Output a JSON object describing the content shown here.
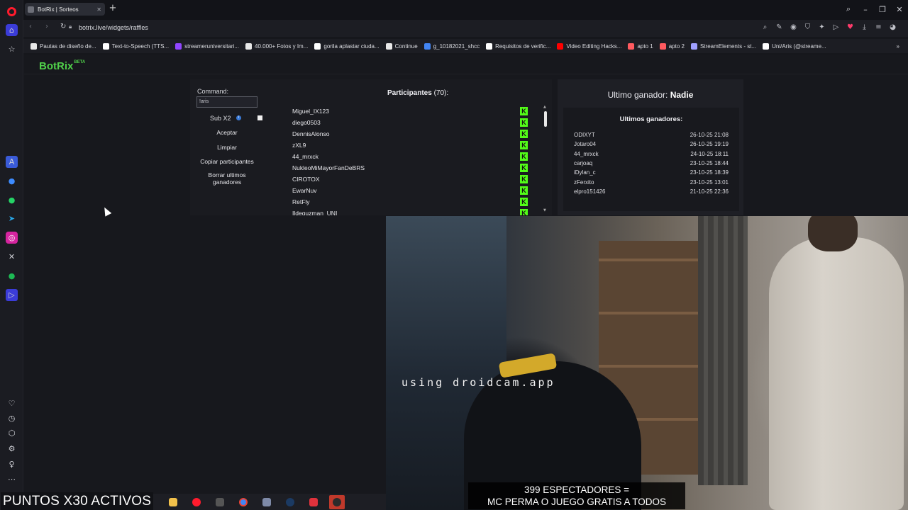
{
  "browser": {
    "tab_title": "BotRix | Sorteos",
    "url": "botrix.live/widgets/raffles",
    "bookmarks": [
      {
        "label": "Pautas de diseño de...",
        "color": "#e8e8e8"
      },
      {
        "label": "Text-to-Speech (TTS...",
        "color": "#ffffff"
      },
      {
        "label": "streameruniversitari...",
        "color": "#9146ff"
      },
      {
        "label": "40.000+ Fotos y Im...",
        "color": "#e8e8e8"
      },
      {
        "label": "gorila aplastar ciuda...",
        "color": "#ffffff"
      },
      {
        "label": "Continue",
        "color": "#e8e8e8"
      },
      {
        "label": "g_10182021_shcc",
        "color": "#4285f4"
      },
      {
        "label": "Requisitos de verific...",
        "color": "#ffffff"
      },
      {
        "label": "Video Editing Hacks...",
        "color": "#ff0000"
      },
      {
        "label": "apto 1",
        "color": "#ff5a5f"
      },
      {
        "label": "apto 2",
        "color": "#ff5a5f"
      },
      {
        "label": "StreamElements - st...",
        "color": "#a0a0ff"
      },
      {
        "label": "Uni/Aris (@streame...",
        "color": "#ffffff"
      }
    ]
  },
  "app": {
    "brand": "BotRix",
    "brand_tag": "BETA",
    "command_label": "Command:",
    "command_value": "!aris",
    "sub_label": "Sub X2",
    "buttons": {
      "accept": "Aceptar",
      "clear": "Limpiar",
      "copy": "Copiar participantes",
      "delete_winners": "Borrar ultimos ganadores"
    },
    "participants_title": "Participantes",
    "participants_count": "(70):",
    "participants": [
      "Miguel_IX123",
      "diego0503",
      "DennisAlonso",
      "zXL9",
      "44_mrxck",
      "NukleoMiMayorFanDeBRS",
      "CIROTOX",
      "EwarNuv",
      "RetFly",
      "Ildeguzman_UNI"
    ],
    "platform_icon": "K",
    "last_winner_label": "Ultimo ganador:",
    "last_winner_name": "Nadie",
    "recent_title": "Ultimos ganadores:",
    "recent_winners": [
      {
        "name": "ODIXYT",
        "date": "26-10-25 21:08"
      },
      {
        "name": "Jotaro04",
        "date": "26-10-25 19:19"
      },
      {
        "name": "44_mrxck",
        "date": "24-10-25 18:11"
      },
      {
        "name": "carjoaq",
        "date": "23-10-25 18:44"
      },
      {
        "name": "iDylan_c",
        "date": "23-10-25 18:39"
      },
      {
        "name": "zFerxito",
        "date": "23-10-25 13:01"
      },
      {
        "name": "elpro151426",
        "date": "21-10-25 22:36"
      }
    ]
  },
  "overlay": {
    "puntos": "PUNTOS X30 ACTIVOS",
    "cam_watermark": "using droidcam.app",
    "caption_line1": "399 ESPECTADORES =",
    "caption_line2": "MC PERMA O JUEGO GRATIS A TODOS"
  }
}
